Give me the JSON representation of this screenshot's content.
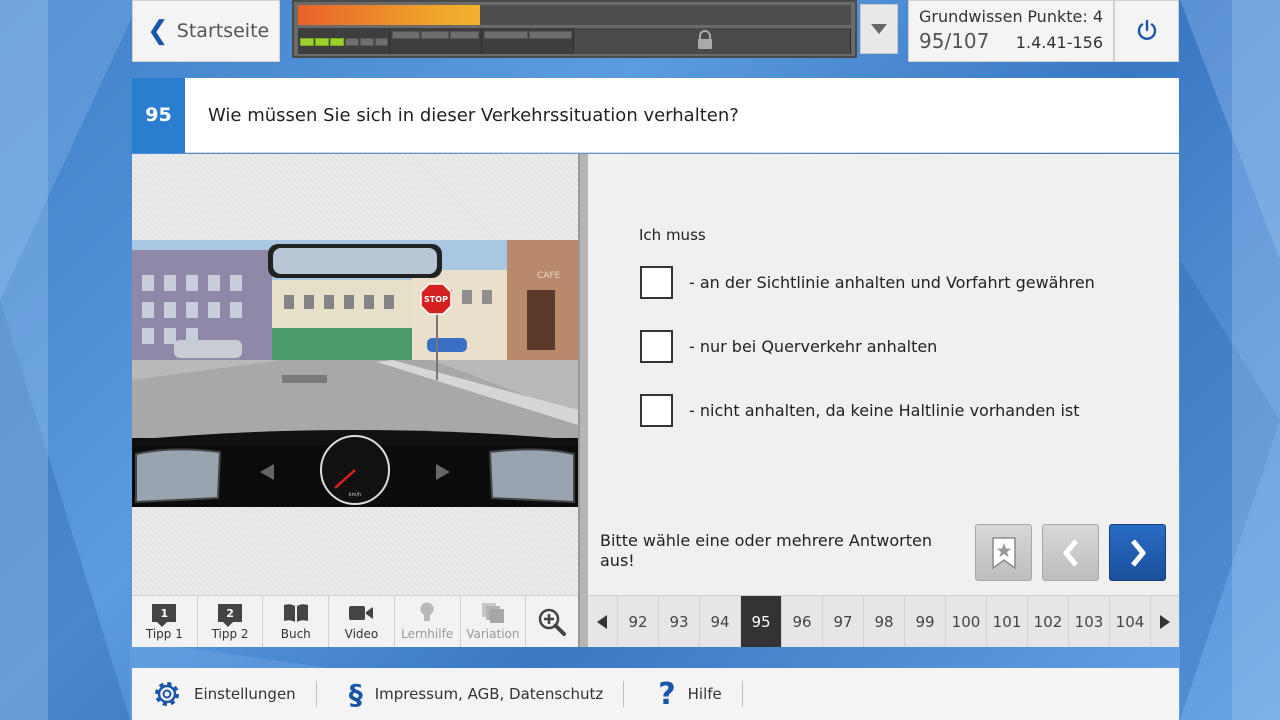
{
  "topbar": {
    "home_label": "Startseite",
    "category": "Grundwissen",
    "points": "Punkte: 4",
    "progress_count": "95/107",
    "version": "1.4.41-156",
    "progress_fraction": 0.33
  },
  "question": {
    "number": "95",
    "text": "Wie müssen Sie sich in dieser Verkehrssituation verhalten?",
    "intro": "Ich muss",
    "answers": [
      "- an der Sichtlinie anhalten und Vorfahrt gewähren",
      "- nur bei Querverkehr anhalten",
      "- nicht anhalten, da keine Haltlinie vorhanden ist"
    ],
    "hint": "Bitte wähle eine oder mehrere Antworten aus!"
  },
  "scene": {
    "stop_sign_text": "STOP",
    "cafe_text": "CAFE",
    "speedo_unit": "km/h"
  },
  "tools": [
    {
      "label": "Tipp 1",
      "badge": "1",
      "enabled": true
    },
    {
      "label": "Tipp 2",
      "badge": "2",
      "enabled": true
    },
    {
      "label": "Buch",
      "enabled": true
    },
    {
      "label": "Video",
      "enabled": true
    },
    {
      "label": "Lernhilfe",
      "enabled": false
    },
    {
      "label": "Variation",
      "enabled": false
    }
  ],
  "pager": [
    "92",
    "93",
    "94",
    "95",
    "96",
    "97",
    "98",
    "99",
    "100",
    "101",
    "102",
    "103",
    "104"
  ],
  "pager_active": "95",
  "footer": {
    "settings": "Einstellungen",
    "legal": "Impressum, AGB, Datenschutz",
    "help": "Hilfe"
  },
  "colors": {
    "accent_blue": "#2a7ed0",
    "nav_blue": "#1b4f9c",
    "progress_orange": "#f0a02a"
  }
}
